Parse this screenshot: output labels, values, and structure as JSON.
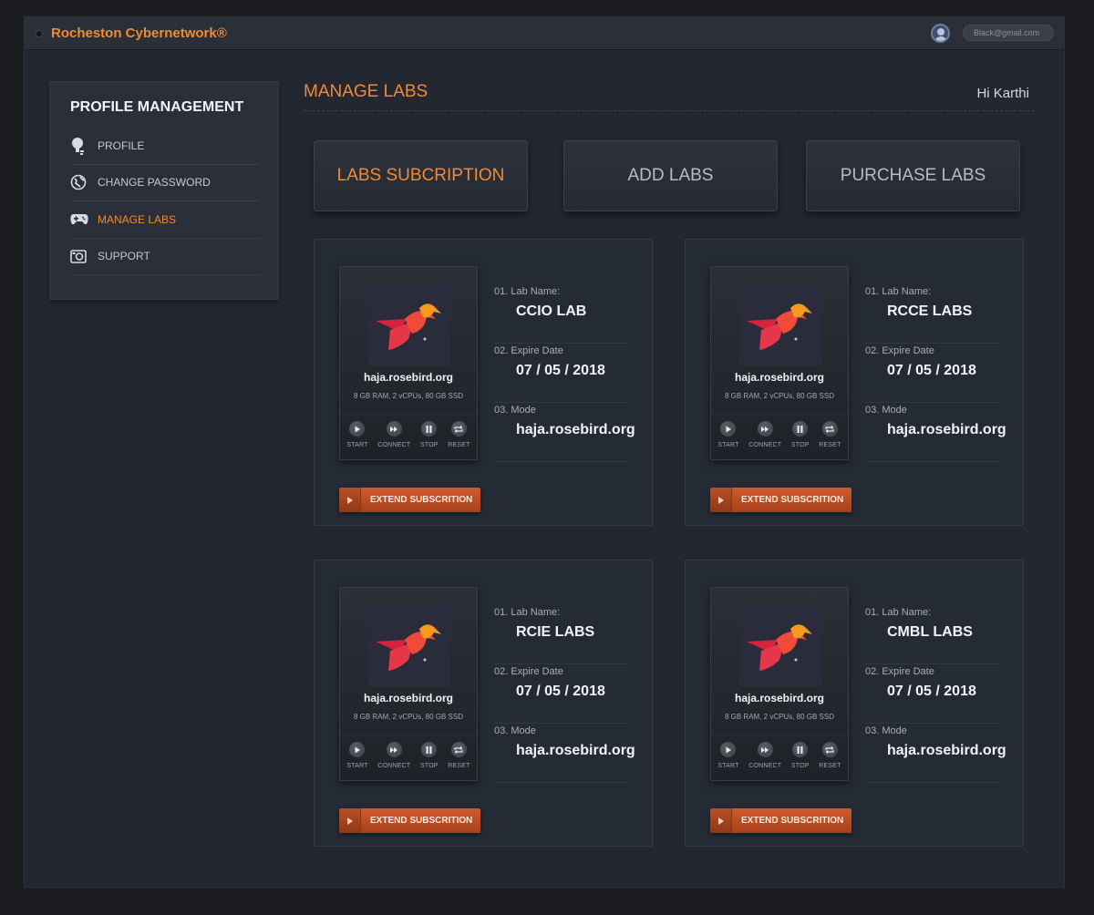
{
  "colors": {
    "accent": "#f08a33",
    "button": "#c4502a",
    "background": "#222731"
  },
  "header": {
    "app_title": "Rocheston Cybernetwork®",
    "email": "Black@gmail.com"
  },
  "sidebar": {
    "heading": "PROFILE MANAGEMENT",
    "items": [
      {
        "label": "PROFILE",
        "icon": "bulb-icon"
      },
      {
        "label": "CHANGE PASSWORD",
        "icon": "globe-icon"
      },
      {
        "label": "MANAGE LABS",
        "icon": "gamepad-icon",
        "active": true
      },
      {
        "label": "SUPPORT",
        "icon": "camera-icon"
      }
    ]
  },
  "main": {
    "title": "MANAGE LABS",
    "greeting": "Hi Karthi",
    "tabs": [
      {
        "label": "LABS SUBCRIPTION",
        "active": true
      },
      {
        "label": "ADD LABS"
      },
      {
        "label": "PURCHASE LABS"
      }
    ]
  },
  "labs": [
    {
      "host": "haja.rosebird.org",
      "specs": "8 GB RAM, 2 vCPUs, 80 GB SSD",
      "lab_name_label": "01.  Lab Name:",
      "lab_name": "CCIO LAB",
      "expire_label": "02.  Expire Date",
      "expire_date": "07 / 05 / 2018",
      "mode_label": "03.  Mode",
      "mode": "haja.rosebird.org",
      "controls": [
        "START",
        "CONNECT",
        "STOP",
        "RESET"
      ],
      "extend_label": "EXTEND SUBSCRITION"
    },
    {
      "host": "haja.rosebird.org",
      "specs": "8 GB RAM, 2 vCPUs, 80 GB SSD",
      "lab_name_label": "01.  Lab Name:",
      "lab_name": "RCCE LABS",
      "expire_label": "02.  Expire Date",
      "expire_date": "07 / 05 / 2018",
      "mode_label": "03.  Mode",
      "mode": "haja.rosebird.org",
      "controls": [
        "START",
        "CONNECT",
        "STOP",
        "RESET"
      ],
      "extend_label": "EXTEND SUBSCRITION"
    },
    {
      "host": "haja.rosebird.org",
      "specs": "8 GB RAM, 2 vCPUs, 80 GB SSD",
      "lab_name_label": "01.  Lab Name:",
      "lab_name": "RCIE LABS",
      "expire_label": "02.  Expire Date",
      "expire_date": "07 / 05 / 2018",
      "mode_label": "03.  Mode",
      "mode": "haja.rosebird.org",
      "controls": [
        "START",
        "CONNECT",
        "STOP",
        "RESET"
      ],
      "extend_label": "EXTEND SUBSCRITION"
    },
    {
      "host": "haja.rosebird.org",
      "specs": "8 GB RAM, 2 vCPUs, 80 GB SSD",
      "lab_name_label": "01.  Lab Name:",
      "lab_name": "CMBL LABS",
      "expire_label": "02.  Expire Date",
      "expire_date": "07 / 05 / 2018",
      "mode_label": "03.  Mode",
      "mode": "haja.rosebird.org",
      "controls": [
        "START",
        "CONNECT",
        "STOP",
        "RESET"
      ],
      "extend_label": "EXTEND SUBSCRITION"
    }
  ]
}
